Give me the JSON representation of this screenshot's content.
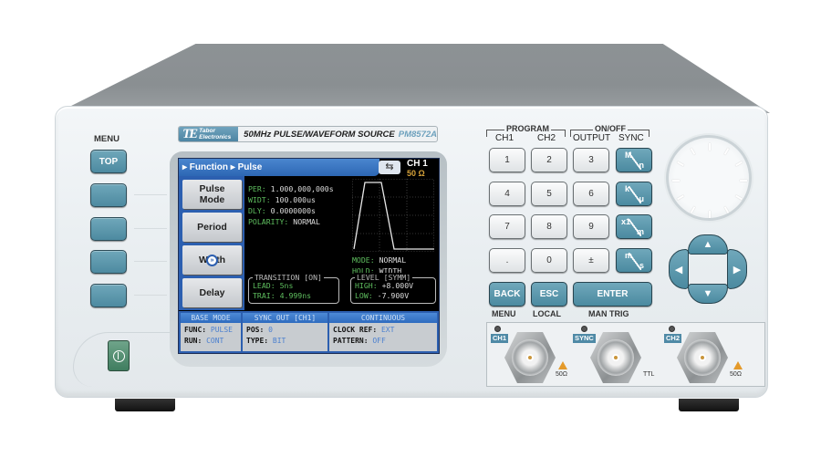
{
  "device": {
    "brand_line1": "Tabor",
    "brand_line2": "Electronics",
    "brand_mark": "TE",
    "title": "50MHz PULSE/WAVEFORM SOURCE",
    "model": "PM8572A"
  },
  "left_panel": {
    "menu_label": "MENU",
    "top_button": "TOP",
    "power_icon": "power-icon"
  },
  "screen": {
    "breadcrumb": "▸ Function ▸ Pulse",
    "usb_icon": "⇆",
    "channel": "CH 1",
    "impedance": "50 Ω",
    "softkeys": [
      "Pulse\nMode",
      "Period",
      "Width",
      "Delay"
    ],
    "more_indicator": "»",
    "params": [
      {
        "label": "PER:",
        "value": " 1.000,000,000s"
      },
      {
        "label": "WIDT:",
        "value": " 100.000us"
      },
      {
        "label": "DLY:",
        "value": " 0.0000000s"
      },
      {
        "label": "POLARITY:",
        "value": " NORMAL"
      }
    ],
    "mode": {
      "label": "MODE:",
      "value": " NORMAL"
    },
    "hold": {
      "label": "HOLD:",
      "value": " WIDTH"
    },
    "transition": {
      "title": "TRANSITION [ON]",
      "lead_label": "LEAD:",
      "lead_value": " 5ns",
      "trail_label": "TRAI:",
      "trail_value": " 4.999ns"
    },
    "level": {
      "title": "LEVEL [SYMM]",
      "high_label": "HIGH:",
      "high_value": " +8.000V",
      "low_label": "LOW:",
      "low_value": "  -7.900V"
    },
    "status": {
      "base_mode": {
        "title": "BASE MODE",
        "func_label": "FUNC:",
        "func_value": " PULSE",
        "run_label": "RUN:",
        "run_value": " CONT"
      },
      "sync_out": {
        "title": "SYNC OUT [CH1]",
        "pos_label": "POS:",
        "pos_value": " 0",
        "type_label": "TYPE:",
        "type_value": " BIT"
      },
      "continuous": {
        "title": "CONTINUOUS",
        "clock_label": "CLOCK REF:",
        "clock_value": " EXT",
        "pattern_label": "PATTERN:",
        "pattern_value": " OFF"
      }
    }
  },
  "keypad": {
    "program_label": "PROGRAM",
    "onoff_label": "ON/OFF",
    "ch1_label": "CH1",
    "ch2_label": "CH2",
    "output_label": "OUTPUT",
    "sync_label": "SYNC",
    "digits": [
      "1",
      "2",
      "3",
      "4",
      "5",
      "6",
      "7",
      "8",
      "9",
      ".",
      "0",
      "±"
    ],
    "units": [
      {
        "top": "M",
        "bottom": "n"
      },
      {
        "top": "k",
        "bottom": "μ"
      },
      {
        "top": "x1",
        "bottom": "m"
      },
      {
        "top": "m",
        "bottom": "s"
      }
    ],
    "back": "BACK",
    "esc": "ESC",
    "enter": "ENTER",
    "back_sub": "MENU",
    "esc_sub": "LOCAL",
    "enter_sub": "MAN TRIG"
  },
  "nav": {
    "up": "▲",
    "down": "▼",
    "left": "◀",
    "right": "▶"
  },
  "outputs": {
    "ch1": "CH1",
    "sync": "SYNC",
    "ch2": "CH2",
    "ch1_impedance": "50Ω",
    "sync_level": "TTL",
    "ch2_impedance": "50Ω"
  }
}
